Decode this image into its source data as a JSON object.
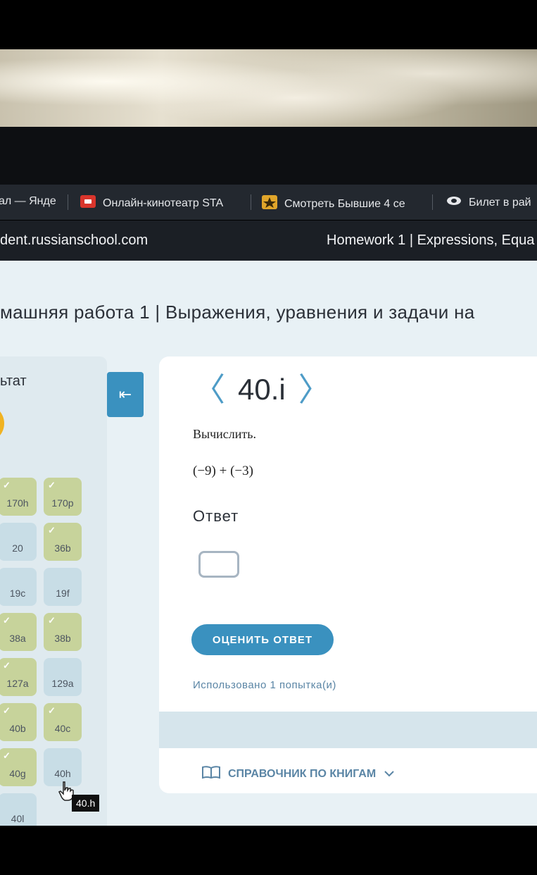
{
  "browser": {
    "tabs": [
      {
        "label": "ал — Янде",
        "icon": "yandex-tab-icon"
      },
      {
        "label": "Онлайн-кинотеатр STA",
        "icon": "red-video-icon"
      },
      {
        "label": "Смотреть Бывшие 4 се",
        "icon": "bookmark-star-icon"
      },
      {
        "label": "Билет в рай",
        "icon": "ticket-icon"
      }
    ],
    "url": "dent.russianschool.com",
    "page_title": "Homework 1 | Expressions, Equa"
  },
  "page": {
    "title": "машняя работа 1 | Выражения, уравнения и задачи на"
  },
  "sidebar": {
    "heading": "ьтат",
    "cells": [
      {
        "label": "170h",
        "state": "done"
      },
      {
        "label": "170p",
        "state": "done"
      },
      {
        "label": "20",
        "state": "open"
      },
      {
        "label": "36b",
        "state": "done"
      },
      {
        "label": "19c",
        "state": "open"
      },
      {
        "label": "19f",
        "state": "open"
      },
      {
        "label": "38a",
        "state": "done"
      },
      {
        "label": "38b",
        "state": "done"
      },
      {
        "label": "127a",
        "state": "done"
      },
      {
        "label": "129a",
        "state": "open"
      },
      {
        "label": "40b",
        "state": "done"
      },
      {
        "label": "40c",
        "state": "done"
      },
      {
        "label": "40g",
        "state": "done"
      },
      {
        "label": "40h",
        "state": "open"
      },
      {
        "label": "40l",
        "state": "open"
      }
    ],
    "collapse_icon": "⇤",
    "tooltip": "40.h"
  },
  "task": {
    "number": "40.i",
    "prev_icon": "〈",
    "next_icon": "〉",
    "prompt": "Вычислить.",
    "expression": "(−9) + (−3)",
    "answer_label": "Ответ",
    "answer_value": "",
    "submit_label": "ОЦЕНИТЬ ОТВЕТ",
    "attempts": "Использовано 1 попытка(и)",
    "reference_label": "СПРАВОЧНИК ПО КНИГАМ"
  },
  "colors": {
    "accent": "#3a91bf",
    "done_cell": "#c7d39b",
    "open_cell": "#c8dde6",
    "page_bg": "#e8f1f5"
  }
}
